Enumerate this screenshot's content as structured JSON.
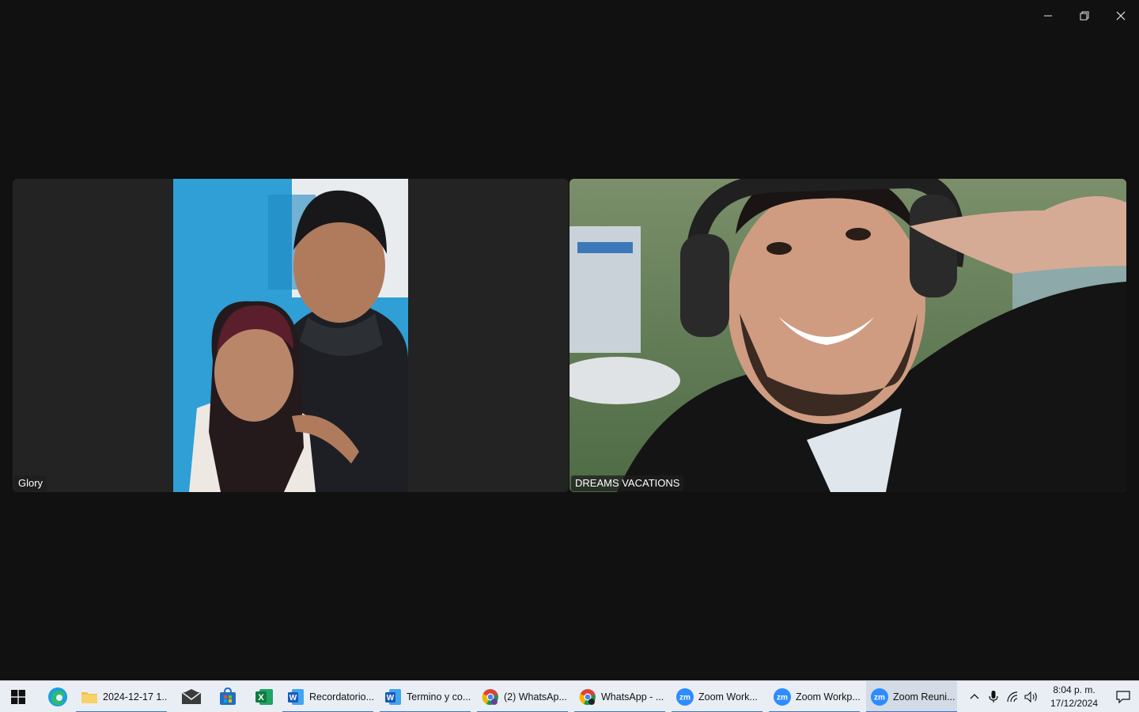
{
  "window_controls": {
    "minimize": "minimize",
    "restore": "restore",
    "close": "close"
  },
  "participants": [
    {
      "name": "Glory"
    },
    {
      "name": "DREAMS VACATIONS"
    }
  ],
  "taskbar": {
    "apps": [
      {
        "label": "2024-12-17 1...",
        "icon": "folder-icon"
      },
      {
        "label": "Recordatorio...",
        "icon": "word-icon"
      },
      {
        "label": "Termino y co...",
        "icon": "word-icon"
      },
      {
        "label": "(2) WhatsAp...",
        "icon": "chrome-icon"
      },
      {
        "label": "WhatsApp - ...",
        "icon": "chrome-icon"
      },
      {
        "label": "Zoom Work...",
        "icon": "zoom-icon"
      },
      {
        "label": "Zoom Workp...",
        "icon": "zoom-icon"
      },
      {
        "label": "Zoom Reuni...",
        "icon": "zoom-icon"
      }
    ],
    "clock": {
      "time": "8:04 p. m.",
      "date": "17/12/2024"
    }
  },
  "colors": {
    "background": "#111111",
    "tile_bg": "#232323",
    "taskbar_bg": "#e9eef5",
    "accent": "#3a77c9"
  }
}
